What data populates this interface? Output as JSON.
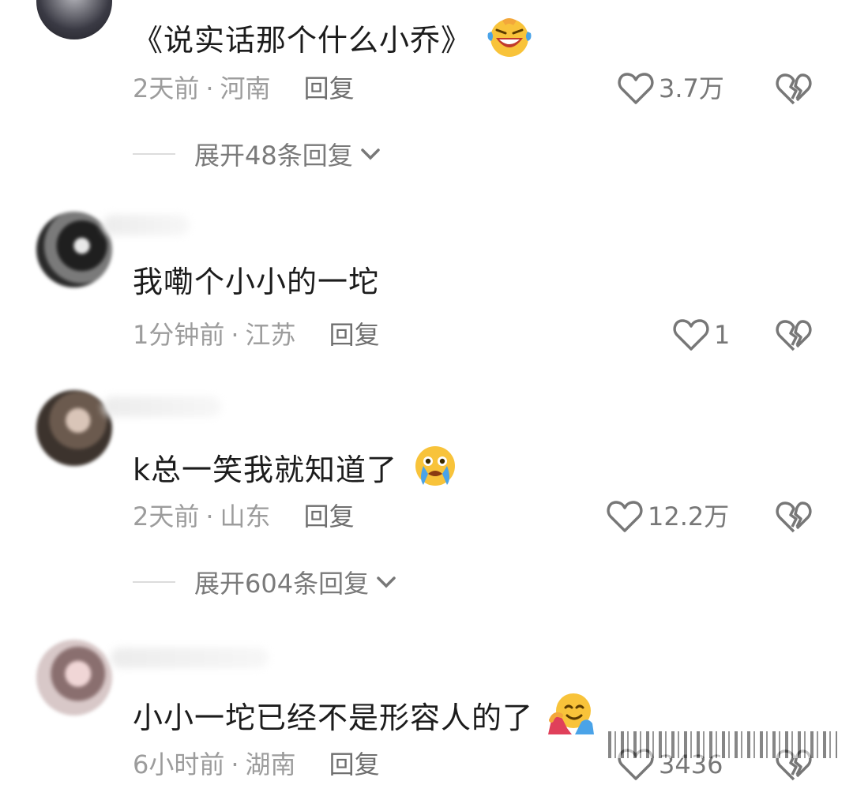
{
  "comments": [
    {
      "text": "《说实话那个什么小乔》",
      "emoji_name": "grinning-squinting-tears-emoji",
      "time": "2天前",
      "location": "河南",
      "reply_label": "回复",
      "likes": "3.7万",
      "expand_label": "展开48条回复"
    },
    {
      "text": "我嘞个小小的一坨",
      "emoji_name": "",
      "time": "1分钟前",
      "location": "江苏",
      "reply_label": "回复",
      "likes": "1",
      "expand_label": ""
    },
    {
      "text": "k总一笑我就知道了",
      "emoji_name": "crying-face-emoji",
      "time": "2天前",
      "location": "山东",
      "reply_label": "回复",
      "likes": "12.2万",
      "expand_label": "展开604条回复"
    },
    {
      "text": "小小一坨已经不是形容人的了",
      "emoji_name": "hugging-face-emoji",
      "time": "6小时前",
      "location": "湖南",
      "reply_label": "回复",
      "likes": "3436",
      "expand_label": ""
    }
  ],
  "separator": "·",
  "colors": {
    "text": "#1c1c1c",
    "meta": "#9c9c9c",
    "icon": "#777777",
    "emoji_yellow": "#f8c33a"
  }
}
